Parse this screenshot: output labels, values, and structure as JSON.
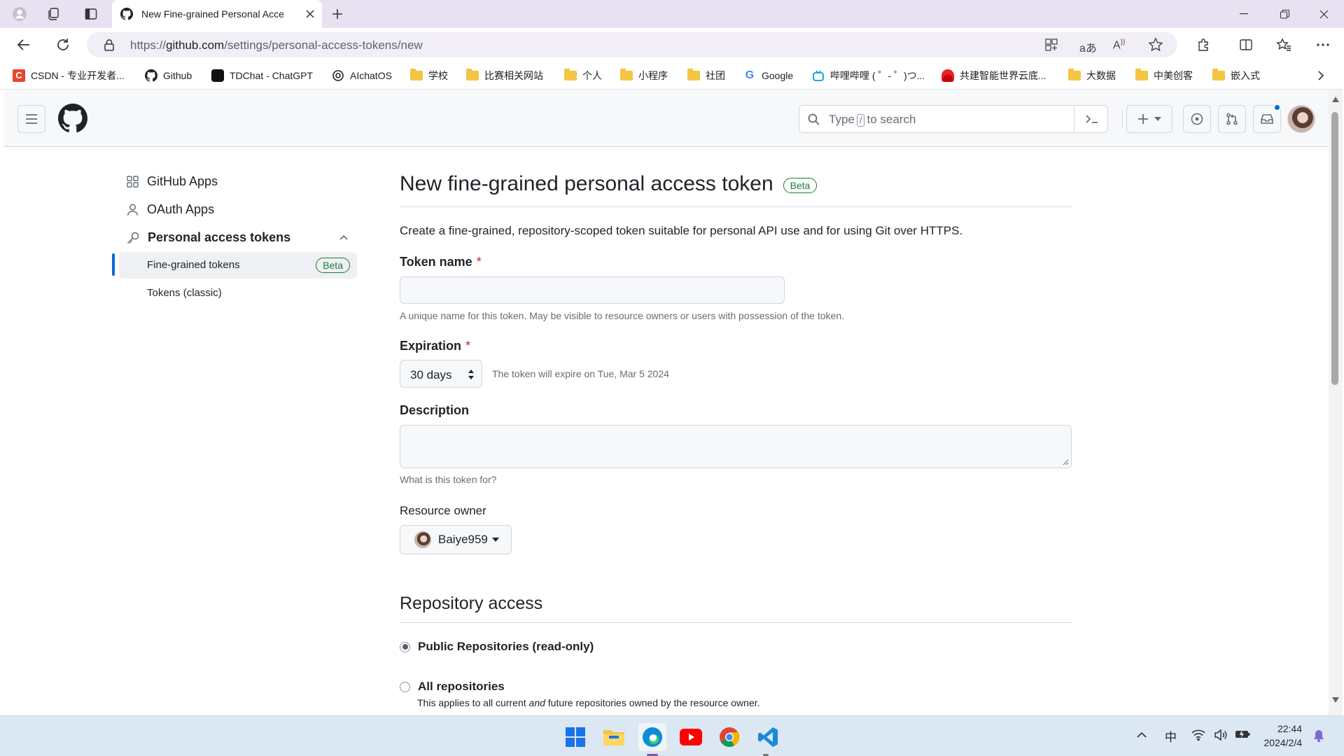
{
  "browser": {
    "tab_title": "New Fine-grained Personal Acce",
    "url_prefix": "https://",
    "url_host": "github.com",
    "url_path": "/settings/personal-access-tokens/new",
    "bookmarks": [
      {
        "label": "CSDN - 专业开发者...",
        "icon": "csdn-icon"
      },
      {
        "label": "Github",
        "icon": "github-icon"
      },
      {
        "label": "TDChat - ChatGPT",
        "icon": "chatgpt-icon"
      },
      {
        "label": "AIchatOS",
        "icon": "openai-icon"
      },
      {
        "label": "学校",
        "icon": "folder-icon"
      },
      {
        "label": "比赛相关网站",
        "icon": "folder-icon"
      },
      {
        "label": "个人",
        "icon": "folder-icon"
      },
      {
        "label": "小程序",
        "icon": "folder-icon"
      },
      {
        "label": "社团",
        "icon": "folder-icon"
      },
      {
        "label": "Google",
        "icon": "google-icon"
      },
      {
        "label": "哔哩哔哩 ( ゜- ゜)つ...",
        "icon": "bilibili-icon"
      },
      {
        "label": "共建智能世界云底...",
        "icon": "huawei-icon"
      },
      {
        "label": "大数据",
        "icon": "folder-icon"
      },
      {
        "label": "中美创客",
        "icon": "folder-icon"
      },
      {
        "label": "嵌入式",
        "icon": "folder-icon"
      }
    ]
  },
  "header": {
    "search_type": "Type",
    "search_key": "/",
    "search_rest": "to search"
  },
  "sidebar": {
    "items": [
      {
        "label": "GitHub Apps",
        "icon": "apps-icon"
      },
      {
        "label": "OAuth Apps",
        "icon": "person-icon"
      },
      {
        "label": "Personal access tokens",
        "icon": "key-icon"
      }
    ],
    "sub_items": [
      {
        "label": "Fine-grained tokens",
        "badge": "Beta",
        "selected": true
      },
      {
        "label": "Tokens (classic)"
      }
    ]
  },
  "main": {
    "title": "New fine-grained personal access token",
    "title_badge": "Beta",
    "intro": "Create a fine-grained, repository-scoped token suitable for personal API use and for using Git over HTTPS.",
    "token_name": {
      "label": "Token name",
      "required": "*",
      "value": "",
      "note": "A unique name for this token. May be visible to resource owners or users with possession of the token."
    },
    "expiration": {
      "label": "Expiration",
      "required": "*",
      "value": "30 days",
      "note": "The token will expire on Tue, Mar 5 2024"
    },
    "description": {
      "label": "Description",
      "value": "",
      "note": "What is this token for?"
    },
    "resource_owner": {
      "label": "Resource owner",
      "value": "Baiye959"
    },
    "repo_access": {
      "title": "Repository access",
      "options": [
        {
          "label": "Public Repositories (read-only)",
          "checked": true
        },
        {
          "label": "All repositories",
          "checked": false,
          "desc_before": "This applies to all current ",
          "desc_em": "and",
          "desc_after": " future repositories owned by the resource owner."
        }
      ]
    }
  },
  "taskbar": {
    "time": "22:44",
    "date": "2024/2/4",
    "ime": "中"
  },
  "colors": {
    "accent": "#0969da",
    "success": "#1a7f37",
    "danger": "#cf222e"
  }
}
